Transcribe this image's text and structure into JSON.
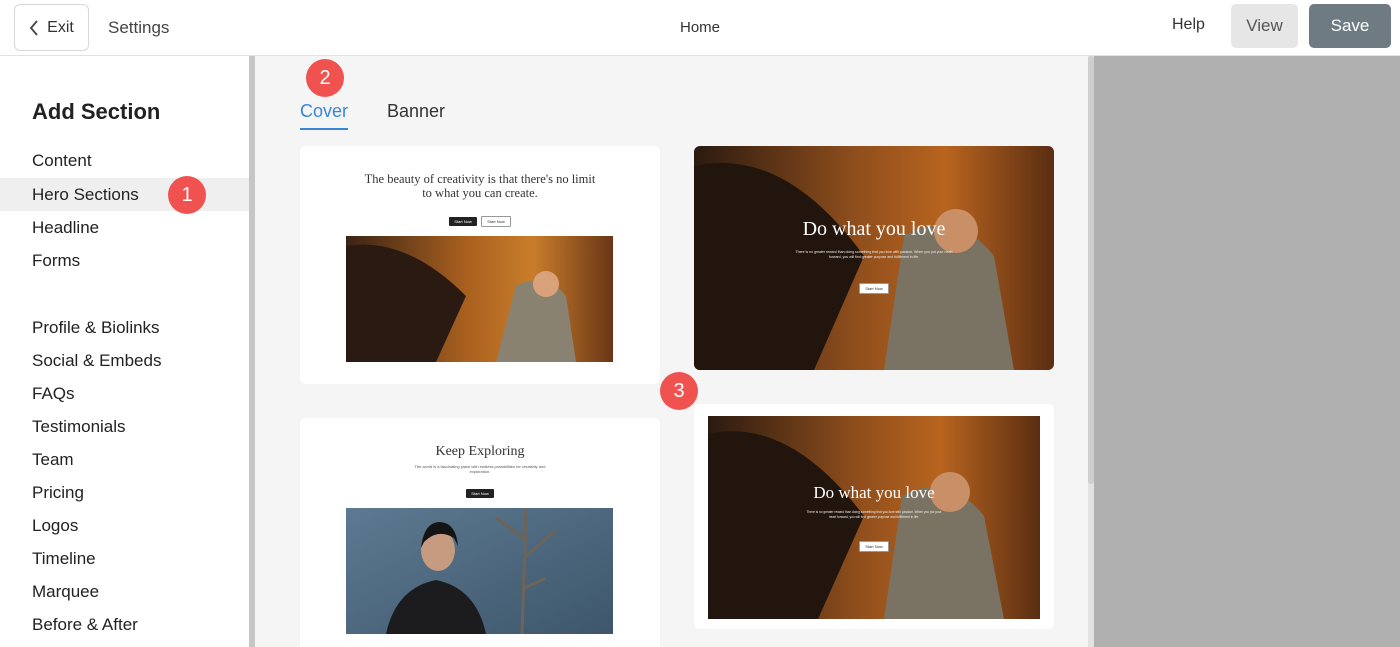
{
  "topbar": {
    "exit_label": "Exit",
    "settings_label": "Settings",
    "page_title": "Home",
    "help_label": "Help",
    "view_label": "View",
    "save_label": "Save"
  },
  "sidebar": {
    "title": "Add Section",
    "items": [
      {
        "label": "Content"
      },
      {
        "label": "Hero Sections",
        "active": true
      },
      {
        "label": "Headline"
      },
      {
        "label": "Forms"
      },
      {
        "label": "Profile & Biolinks"
      },
      {
        "label": "Social & Embeds"
      },
      {
        "label": "FAQs"
      },
      {
        "label": "Testimonials"
      },
      {
        "label": "Team"
      },
      {
        "label": "Pricing"
      },
      {
        "label": "Logos"
      },
      {
        "label": "Timeline"
      },
      {
        "label": "Marquee"
      },
      {
        "label": "Before & After"
      }
    ]
  },
  "badges": [
    "1",
    "2",
    "3"
  ],
  "tabs": [
    {
      "label": "Cover",
      "active": true
    },
    {
      "label": "Banner",
      "active": false
    }
  ],
  "cards": {
    "card1": {
      "heading": "The beauty of creativity is that there's no limit to what you can create.",
      "button1": "Start Now",
      "button2": "Start Now"
    },
    "card2": {
      "heading": "Do what you love",
      "body": "There is no greater reward than doing something that you love with passion. When you put your heart forward, you will find greater purpose and fulfillment in life.",
      "button": "Start Now"
    },
    "card3": {
      "heading": "Keep Exploring",
      "body": "The world is a fascinating place with endless possibilities for creativity and exploration.",
      "button": "Start Now"
    },
    "card4": {
      "heading": "Do what you love",
      "body": "There is no greater reward than doing something that you love with passion. When you put your heart forward, you will find greater purpose and fulfillment in life.",
      "button": "Start Now"
    }
  },
  "colors": {
    "accent": "#3a86d6",
    "badge": "#f0524f",
    "save_button": "#6f7b83"
  },
  "icons": {
    "exit": "chevron-left-icon"
  }
}
